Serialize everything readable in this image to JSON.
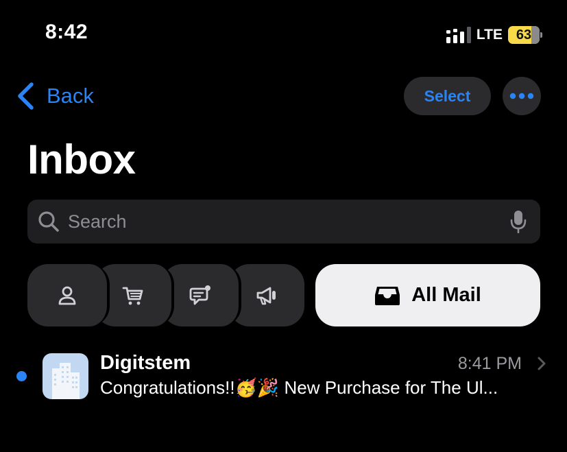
{
  "status_bar": {
    "time": "8:42",
    "network": "LTE",
    "battery": "63"
  },
  "nav": {
    "back_label": "Back",
    "select_label": "Select",
    "more_icon": "ellipsis-icon"
  },
  "title": "Inbox",
  "search": {
    "placeholder": "Search",
    "value": ""
  },
  "categories": {
    "icons": [
      "person-icon",
      "cart-icon",
      "chat-icon",
      "megaphone-icon"
    ],
    "all_mail_label": "All Mail"
  },
  "mail": [
    {
      "sender": "Digitstem",
      "time": "8:41 PM",
      "preview": "Congratulations!!🥳🎉 New Purchase for The Ul...",
      "unread": true
    }
  ],
  "colors": {
    "accent": "#2a84f6",
    "battery": "#f7d94a",
    "chip": "#2b2b2d",
    "avatar": "#c2d8f2"
  }
}
